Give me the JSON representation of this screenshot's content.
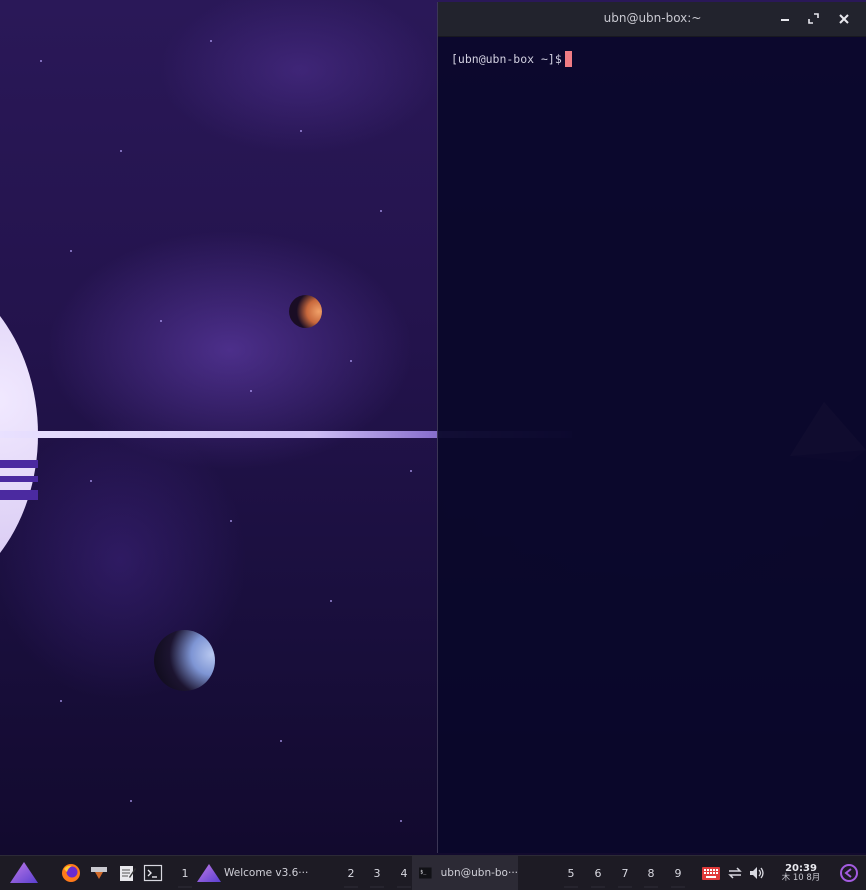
{
  "terminal": {
    "title": "ubn@ubn-box:~",
    "prompt": "[ubn@ubn-box ~]$"
  },
  "taskbar": {
    "launcher_icon": "arch-triangle-menu-icon",
    "pinned_apps": [
      "firefox-icon",
      "files-icon",
      "text-editor-icon",
      "terminal-icon"
    ],
    "workspaces_left": [
      "1"
    ],
    "task_welcome": "Welcome v3.6···",
    "workspaces_mid": [
      "2",
      "3",
      "4"
    ],
    "task_terminal": "ubn@ubn-bo···",
    "workspaces_right": [
      "5",
      "6",
      "7",
      "8",
      "9"
    ],
    "tray": [
      "keyboard-icon",
      "network-sync-icon",
      "volume-icon"
    ],
    "clock_time": "20:39",
    "clock_date": "木 10 8月",
    "logout_icon": "power-icon"
  },
  "colors": {
    "taskbar_bg": "#1d1b24",
    "terminal_bg": "#0a072a",
    "cursor": "#f07c84",
    "accent": "#a35be0"
  }
}
